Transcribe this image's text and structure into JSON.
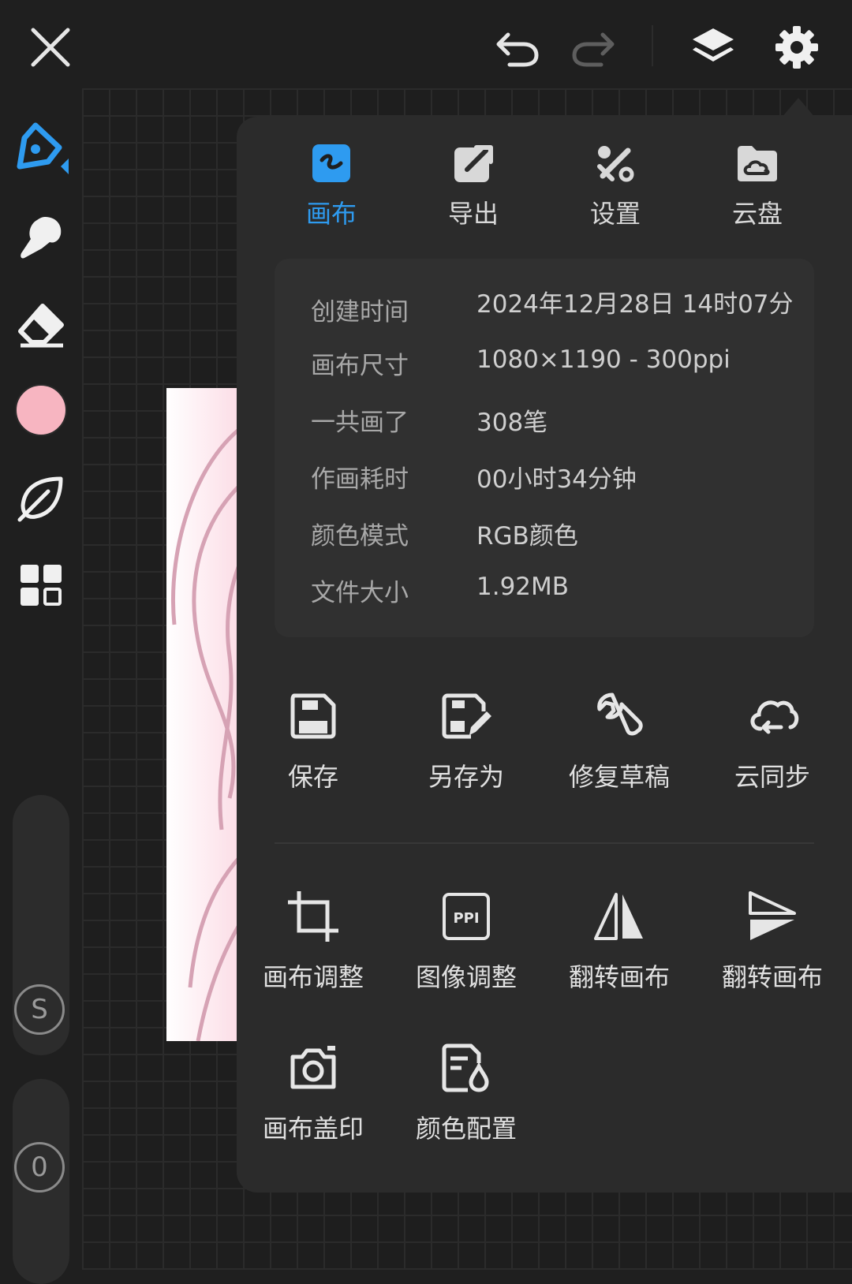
{
  "toolbar": {
    "close": "close-icon",
    "undo": "undo-icon",
    "redo": "redo-icon",
    "layers": "layers-icon",
    "settings": "gear-icon"
  },
  "left_tools": {
    "brush": "brush-icon",
    "smudge": "smudge-icon",
    "eraser": "eraser-icon",
    "current_color": "#f7b5c1",
    "leaf": "leaf-icon",
    "grid": "grid-icon",
    "size_slider_label": "S",
    "opacity_slider_label": "0"
  },
  "panel": {
    "tabs": [
      {
        "label": "画布",
        "icon": "canvas-icon",
        "active": true
      },
      {
        "label": "导出",
        "icon": "export-icon",
        "active": false
      },
      {
        "label": "设置",
        "icon": "tools-icon",
        "active": false
      },
      {
        "label": "云盘",
        "icon": "cloud-folder-icon",
        "active": false
      }
    ],
    "info": [
      {
        "key": "创建时间",
        "value": "2024年12月28日 14时07分"
      },
      {
        "key": "画布尺寸",
        "value": "1080×1190 - 300ppi"
      },
      {
        "key": "一共画了",
        "value": "308笔"
      },
      {
        "key": "作画耗时",
        "value": "00小时34分钟"
      },
      {
        "key": "颜色模式",
        "value": "RGB颜色"
      },
      {
        "key": "文件大小",
        "value": "1.92MB"
      }
    ],
    "actions_row1": [
      {
        "label": "保存",
        "icon": "save-icon"
      },
      {
        "label": "另存为",
        "icon": "save-as-icon"
      },
      {
        "label": "修复草稿",
        "icon": "wrench-icon"
      },
      {
        "label": "云同步",
        "icon": "cloud-sync-icon"
      }
    ],
    "actions_row2": [
      {
        "label": "画布调整",
        "icon": "crop-icon"
      },
      {
        "label": "图像调整",
        "icon": "ppi-icon"
      },
      {
        "label": "翻转画布",
        "icon": "flip-horizontal-icon"
      },
      {
        "label": "翻转画布",
        "icon": "flip-vertical-icon"
      }
    ],
    "actions_row3": [
      {
        "label": "画布盖印",
        "icon": "camera-icon"
      },
      {
        "label": "颜色配置",
        "icon": "color-config-icon"
      }
    ],
    "accent_color": "#2e9bf0"
  }
}
